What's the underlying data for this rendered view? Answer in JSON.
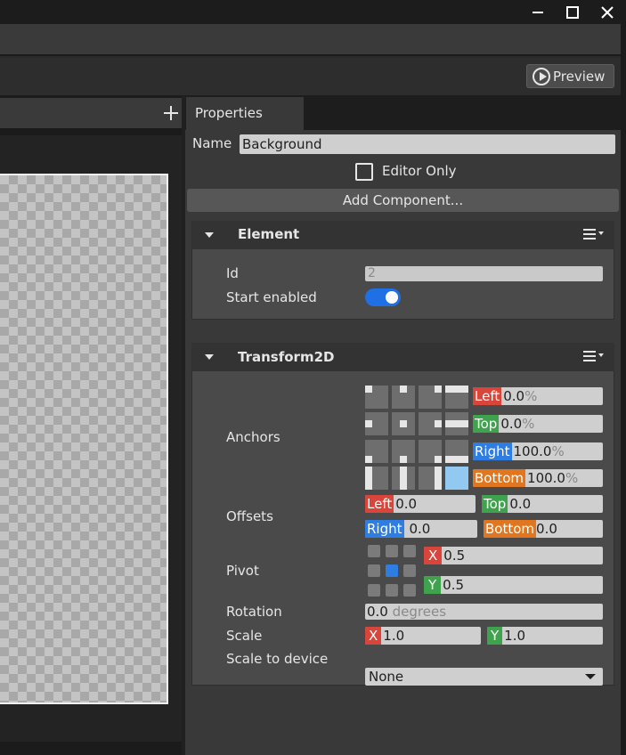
{
  "window": {
    "minimize_icon": "minimize-icon",
    "maximize_icon": "maximize-icon",
    "close_icon": "close-icon"
  },
  "toolbar": {
    "preview_label": "Preview"
  },
  "scene": {
    "add_icon": "plus-icon"
  },
  "properties": {
    "tab_label": "Properties",
    "name_label": "Name",
    "name_value": "Background",
    "editor_only_label": "Editor Only",
    "editor_only_checked": false,
    "add_component_label": "Add Component..."
  },
  "element": {
    "title": "Element",
    "id_label": "Id",
    "id_value": "2",
    "start_enabled_label": "Start enabled",
    "start_enabled": true
  },
  "transform": {
    "title": "Transform2D",
    "anchors_label": "Anchors",
    "anchors": {
      "left_tag": "Left",
      "left_value": "0.0",
      "left_unit": "%",
      "top_tag": "Top",
      "top_value": "0.0",
      "top_unit": "%",
      "right_tag": "Right",
      "right_value": "100.0",
      "right_unit": "%",
      "bottom_tag": "Bottom",
      "bottom_value": "100.0",
      "bottom_unit": "%"
    },
    "offsets_label": "Offsets",
    "offsets": {
      "left_tag": "Left",
      "left_value": "0.0",
      "top_tag": "Top",
      "top_value": "0.0",
      "right_tag": "Right",
      "right_value": "0.0",
      "bottom_tag": "Bottom",
      "bottom_value": "0.0"
    },
    "pivot_label": "Pivot",
    "pivot": {
      "x_tag": "X",
      "x_value": "0.5",
      "y_tag": "Y",
      "y_value": "0.5"
    },
    "rotation_label": "Rotation",
    "rotation_value": "0.0",
    "rotation_unit": "degrees",
    "scale_label": "Scale",
    "scale": {
      "x_tag": "X",
      "x_value": "1.0",
      "y_tag": "Y",
      "y_value": "1.0"
    },
    "scale_to_device_label": "Scale to device",
    "scale_to_device_value": "None"
  },
  "colors": {
    "accent": "#1f6fe5",
    "tag_red": "#d9453a",
    "tag_green": "#3fa34d",
    "tag_blue": "#2f7de1",
    "tag_orange": "#e0761f"
  }
}
